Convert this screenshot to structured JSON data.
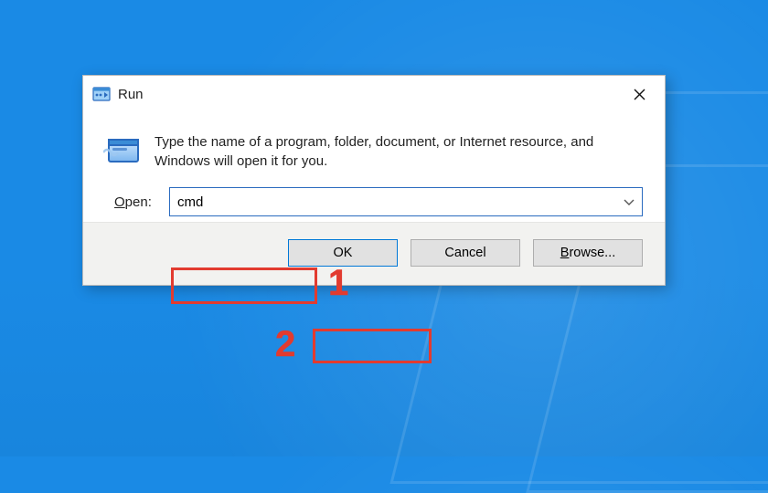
{
  "dialog": {
    "title": "Run",
    "description": "Type the name of a program, folder, document, or Internet resource, and Windows will open it for you.",
    "open_label_prefix": "O",
    "open_label_rest": "pen:",
    "input_value": "cmd",
    "buttons": {
      "ok": "OK",
      "cancel": "Cancel",
      "browse_prefix": "B",
      "browse_rest": "rowse..."
    }
  },
  "annotations": {
    "one": "1",
    "two": "2"
  }
}
